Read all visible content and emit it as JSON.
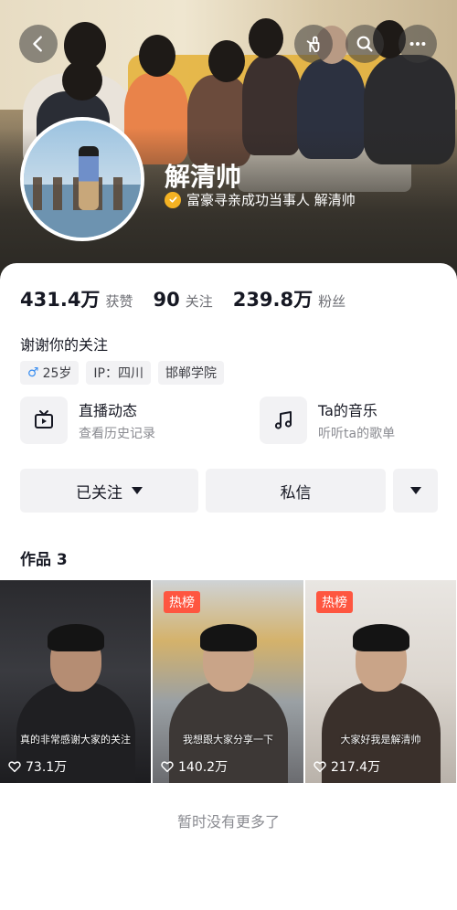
{
  "profile": {
    "name": "解清帅",
    "verification": "富豪寻亲成功当事人 解清帅"
  },
  "stats": [
    {
      "value": "431.4万",
      "label": "获赞"
    },
    {
      "value": "90",
      "label": "关注"
    },
    {
      "value": "239.8万",
      "label": "粉丝"
    }
  ],
  "bio": "谢谢你的关注",
  "tags": {
    "gender_symbol": "♂",
    "age": "25岁",
    "ip": "IP：四川",
    "school": "邯郸学院"
  },
  "features": [
    {
      "title": "直播动态",
      "subtitle": "查看历史记录",
      "icon": "tv-icon"
    },
    {
      "title": "Ta的音乐",
      "subtitle": "听听ta的歌单",
      "icon": "music-note-icon"
    }
  ],
  "actions": {
    "follow_label": "已关注",
    "message_label": "私信"
  },
  "works": {
    "title": "作品 3",
    "items": [
      {
        "caption": "真的非常感谢大家的关注",
        "likes": "73.1万",
        "badge": ""
      },
      {
        "caption": "我想跟大家分享一下",
        "likes": "140.2万",
        "badge": "热榜"
      },
      {
        "caption": "大家好我是解清帅",
        "likes": "217.4万",
        "badge": "热榜"
      }
    ]
  },
  "footer": "暂时没有更多了",
  "colors": {
    "hot_badge": "#fe5640",
    "verify_badge": "#f4b223",
    "male": "#3a8ef0"
  }
}
